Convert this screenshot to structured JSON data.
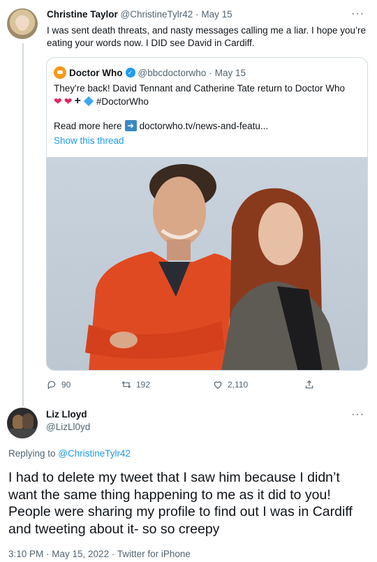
{
  "parent_tweet": {
    "author_name": "Christine Taylor",
    "author_handle": "@ChristineTylr42",
    "date": "May 15",
    "text": "I was sent death threats, and nasty messages calling me a liar. I hope you’re eating your words now. I DID see David in Cardiff.",
    "more_glyph": "···",
    "quoted": {
      "author_name": "Doctor Who",
      "author_handle": "@bbcdoctorwho",
      "date": "May 15",
      "text": "They're back! David Tennant and Catherine Tate return to Doctor Who",
      "hashtag": "#DoctorWho",
      "read_more_label": "Read more here",
      "link_text": "doctorwho.tv/news-and-featu...",
      "show_thread": "Show this thread"
    },
    "actions": {
      "replies": "90",
      "retweets": "192",
      "likes": "2,110"
    }
  },
  "main_tweet": {
    "author_name": "Liz Lloyd",
    "author_handle": "@LizLl0yd",
    "more_glyph": "···",
    "replying_prefix": "Replying to",
    "replying_handle": "@ChristineTylr42",
    "text": "I had to delete my tweet that I saw him because I didn’t want the same thing happening to me as it did to you! People were sharing my profile to find out I was in Cardiff and tweeting about it- so so creepy",
    "timestamp": "3:10 PM · May 15, 2022 · Twitter for iPhone"
  },
  "colors": {
    "accent": "#1d9bf0",
    "muted": "#536471",
    "border": "#cfd9de",
    "heart": "#e0245e"
  },
  "icons": [
    "reply-icon",
    "retweet-icon",
    "like-icon",
    "share-icon",
    "verified-icon",
    "arrow-right-icon",
    "more-icon"
  ]
}
